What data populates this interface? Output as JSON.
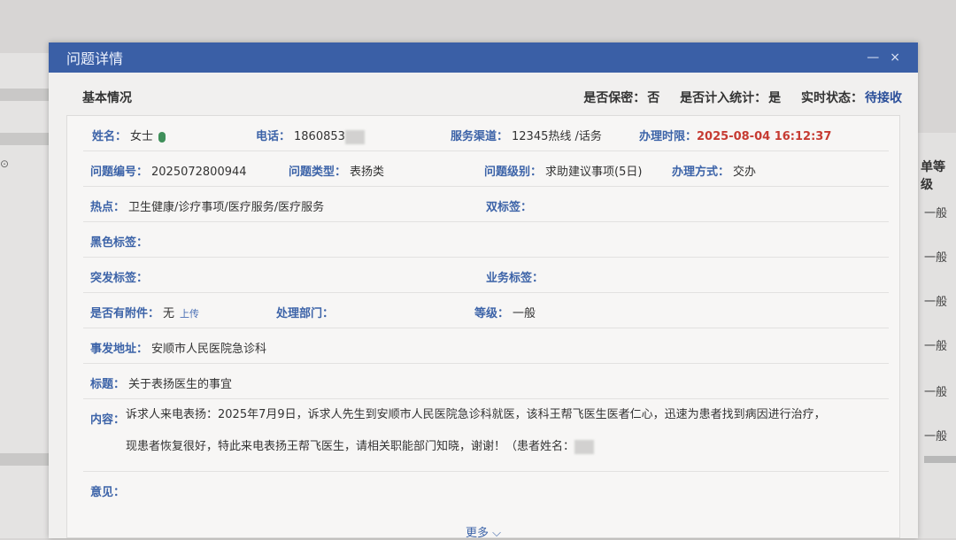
{
  "dialog": {
    "title": "问题详情",
    "minimize": "—",
    "close": "×"
  },
  "summary": {
    "section_title": "基本情况",
    "confidential_label": "是否保密：",
    "confidential_value": "否",
    "counted_label": "是否计入统计：",
    "counted_value": "是",
    "status_label": "实时状态：",
    "status_value": "待接收"
  },
  "fields": {
    "name_label": "姓名：",
    "name_value": "女士",
    "phone_label": "电话：",
    "phone_value": "1860853",
    "channel_label": "服务渠道：",
    "channel_value": "12345热线 /话务",
    "deadline_label": "办理时限：",
    "deadline_value": "2025-08-04 16:12:37",
    "issue_no_label": "问题编号：",
    "issue_no_value": "2025072800944",
    "issue_type_label": "问题类型：",
    "issue_type_value": "表扬类",
    "issue_level_label": "问题级别：",
    "issue_level_value": "求助建议事项(5日)",
    "handling_label": "办理方式：",
    "handling_value": "交办",
    "hotspot_label": "热点：",
    "hotspot_value": "卫生健康/诊疗事项/医疗服务/医疗服务",
    "double_tag_label": "双标签：",
    "double_tag_value": "",
    "black_tag_label": "黑色标签：",
    "black_tag_value": "",
    "sudden_tag_label": "突发标签：",
    "sudden_tag_value": "",
    "business_tag_label": "业务标签：",
    "business_tag_value": "",
    "attachment_label": "是否有附件：",
    "attachment_value": "无",
    "upload_link": "上传",
    "dept_label": "处理部门：",
    "dept_value": "",
    "grade_label": "等级：",
    "grade_value": "一般",
    "address_label": "事发地址：",
    "address_value": "安顺市人民医院急诊科",
    "subject_label": "标题：",
    "subject_value": "关于表扬医生的事宜",
    "content_label": "内容：",
    "content_line1": "诉求人来电表扬：2025年7月9日，诉求人先生到安顺市人民医院急诊科就医，该科王帮飞医生医者仁心，迅速为患者找到病因进行治疗，",
    "content_line2": "现患者恢复很好，特此来电表扬王帮飞医生，请相关职能部门知晓，谢谢！（患者姓名：",
    "opinion_label": "意见：",
    "opinion_value": "",
    "more_link": "更多"
  },
  "background": {
    "right_header": "单等级",
    "right_cells": [
      "一般",
      "一般",
      "一般",
      "一般",
      "一般",
      "一般"
    ]
  }
}
